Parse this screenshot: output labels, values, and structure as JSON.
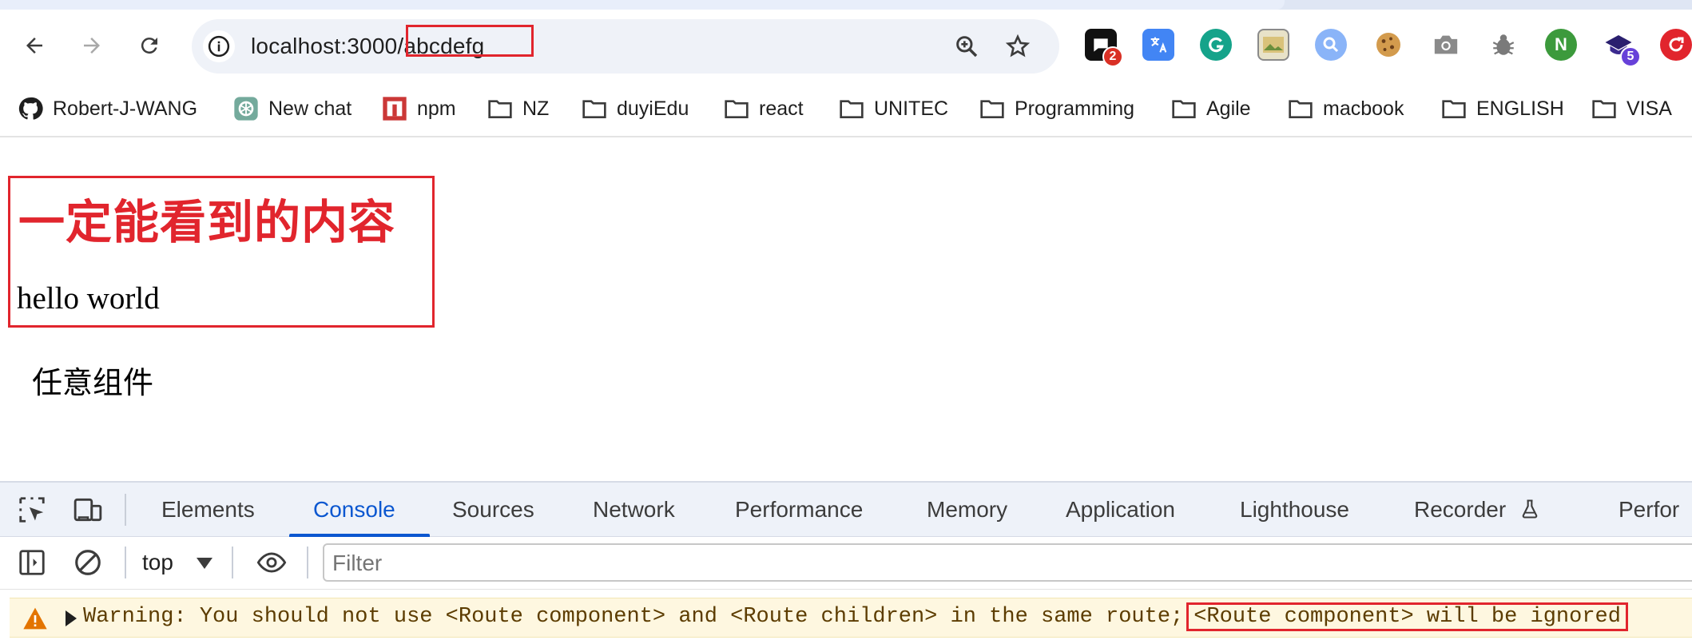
{
  "browser": {
    "url": "localhost:3000/abcdefg",
    "bookmarks": [
      {
        "label": "Robert-J-WANG",
        "icon": "github-icon"
      },
      {
        "label": "New chat",
        "icon": "chatgpt-icon"
      },
      {
        "label": "npm",
        "icon": "npm-icon"
      },
      {
        "label": "NZ",
        "icon": "folder-icon"
      },
      {
        "label": "duyiEdu",
        "icon": "folder-icon"
      },
      {
        "label": "react",
        "icon": "folder-icon"
      },
      {
        "label": "UNITEC",
        "icon": "folder-icon"
      },
      {
        "label": "Programming",
        "icon": "folder-icon"
      },
      {
        "label": "Agile",
        "icon": "folder-icon"
      },
      {
        "label": "macbook",
        "icon": "folder-icon"
      },
      {
        "label": "ENGLISH",
        "icon": "folder-icon"
      },
      {
        "label": "VISA",
        "icon": "folder-icon"
      }
    ],
    "extensions": [
      {
        "icon": "chat-extension-icon",
        "badge": "2",
        "color": "#111111",
        "badge_color": "#d93025"
      },
      {
        "icon": "translate-extension-icon",
        "color": "#4285f4"
      },
      {
        "icon": "grammarly-icon",
        "color": "#15a38a"
      },
      {
        "icon": "image-extension-icon",
        "color": "#c8a84b"
      },
      {
        "icon": "search-extension-icon",
        "color": "#8ab4f8"
      },
      {
        "icon": "cookie-icon",
        "color": "#c98a3c"
      },
      {
        "icon": "camera-icon",
        "color": "#8a8a8a"
      },
      {
        "icon": "bug-icon",
        "color": "#7a7a7a"
      },
      {
        "icon": "node-icon",
        "color": "#3c9a3c"
      },
      {
        "icon": "graduation-extension-icon",
        "badge": "5",
        "color": "#3b2a8f",
        "badge_color": "#6741d9"
      },
      {
        "icon": "refresh-extension-icon",
        "color": "#e1252d"
      }
    ]
  },
  "page": {
    "heading": "一定能看到的内容",
    "hello": "hello world",
    "any_component": "任意组件"
  },
  "devtools": {
    "tabs": [
      "Elements",
      "Console",
      "Sources",
      "Network",
      "Performance",
      "Memory",
      "Application",
      "Lighthouse",
      "Recorder",
      "Perfor"
    ],
    "active_tab": "Console",
    "context": "top",
    "filter_placeholder": "Filter",
    "warning_text": "Warning: You should not use <Route component> and <Route children> in the same route;",
    "warning_highlight": "<Route component> will be ignored"
  },
  "colors": {
    "accent": "#0b57d0",
    "annotation_red": "#e1252d",
    "warning_bg": "#fef7e0"
  }
}
